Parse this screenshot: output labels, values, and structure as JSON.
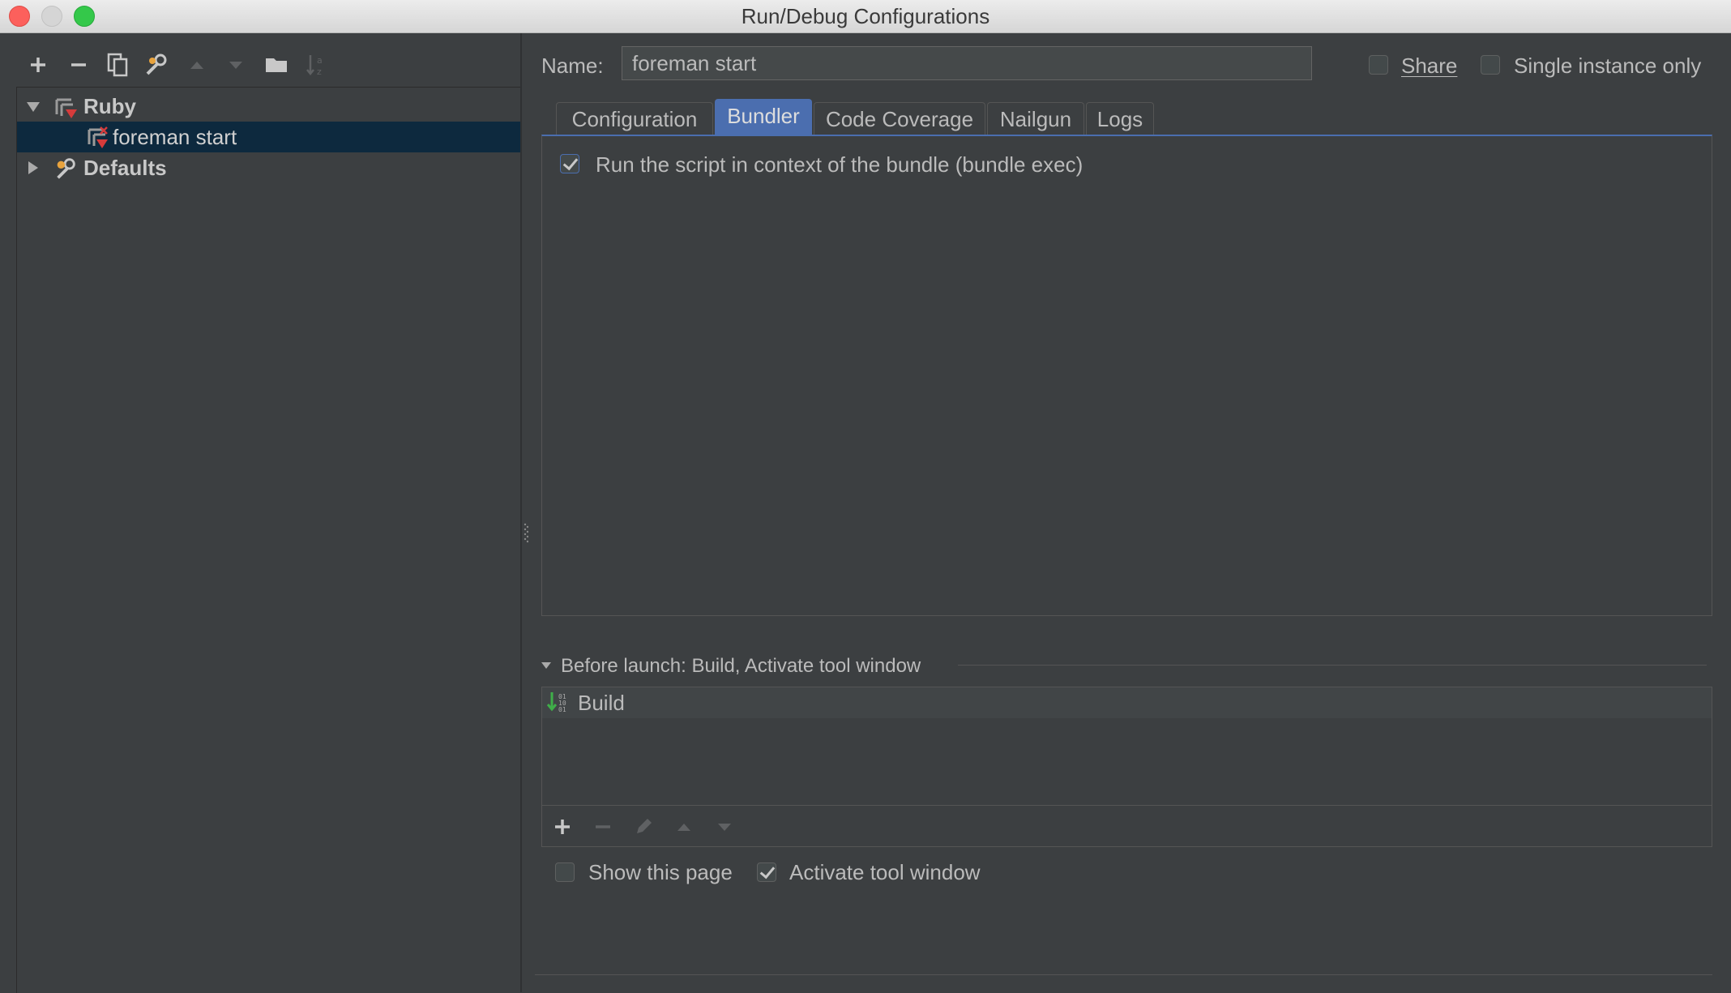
{
  "window": {
    "title": "Run/Debug Configurations"
  },
  "left_toolbar": {
    "icons": [
      "add-icon",
      "remove-icon",
      "copy-icon",
      "wrench-icon",
      "move-up-icon",
      "move-down-icon",
      "folder-icon",
      "sort-icon"
    ]
  },
  "tree": {
    "items": [
      {
        "label": "Ruby",
        "expanded": true,
        "bold": true
      },
      {
        "label": "foreman start",
        "selected": true
      },
      {
        "label": "Defaults",
        "expanded": false,
        "bold": true
      }
    ]
  },
  "config": {
    "name_label": "Name:",
    "name_value": "foreman start",
    "share_label": "Share",
    "share_checked": false,
    "single_instance_label": "Single instance only",
    "single_instance_checked": false
  },
  "tabs": [
    {
      "label": "Configuration"
    },
    {
      "label": "Bundler",
      "active": true
    },
    {
      "label": "Code Coverage"
    },
    {
      "label": "Nailgun"
    },
    {
      "label": "Logs"
    }
  ],
  "bundler": {
    "bundle_exec_label": "Run the script in context of the bundle (bundle exec)",
    "bundle_exec_checked": true
  },
  "before_launch": {
    "header": "Before launch: Build, Activate tool window",
    "items": [
      {
        "label": "Build"
      }
    ],
    "toolbar_icons": [
      "add-icon",
      "remove-icon",
      "edit-icon",
      "move-up-icon",
      "move-down-icon"
    ]
  },
  "footer_options": {
    "show_page_label": "Show this page",
    "show_page_checked": false,
    "activate_label": "Activate tool window",
    "activate_checked": true
  },
  "colors": {
    "accent": "#4b6eaf",
    "background": "#3c3f41",
    "selection": "#0d293e",
    "text": "#bbbbbb"
  }
}
